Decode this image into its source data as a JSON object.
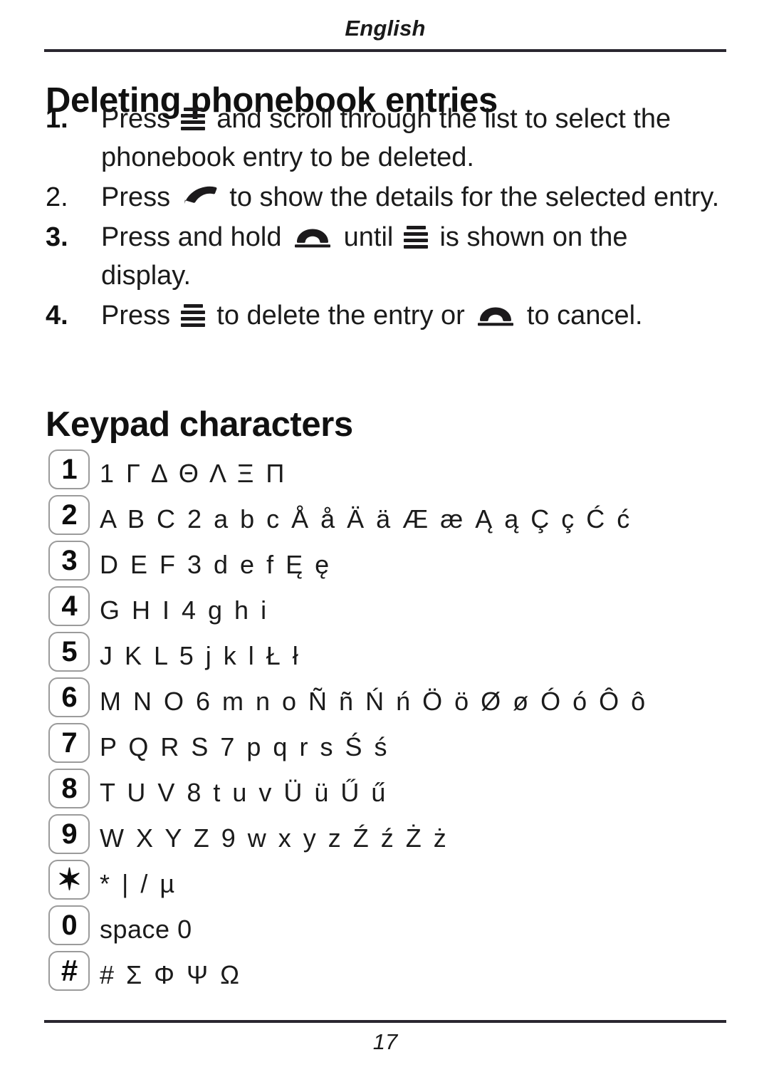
{
  "running_head": "English",
  "headings": {
    "deleting": "Deleting phonebook entries",
    "keypad": "Keypad characters"
  },
  "steps": [
    {
      "number": "1.",
      "bold": true,
      "parts": [
        {
          "type": "text",
          "value": "Press "
        },
        {
          "type": "icon",
          "icon": "menu-icon"
        },
        {
          "type": "text",
          "value": " and scroll through the list to select the phonebook entry to be deleted."
        }
      ],
      "plain_text": "Press ☰ and scroll through the list to select the phonebook entry to be deleted."
    },
    {
      "number": "2.",
      "bold": false,
      "parts": [
        {
          "type": "text",
          "value": "Press "
        },
        {
          "type": "icon",
          "icon": "call-icon"
        },
        {
          "type": "text",
          "value": " to show the details for the selected entry."
        }
      ],
      "plain_text": "Press ☎ to show the details for the selected entry."
    },
    {
      "number": "3.",
      "bold": true,
      "parts": [
        {
          "type": "text",
          "value": "Press and hold "
        },
        {
          "type": "icon",
          "icon": "end-call-icon"
        },
        {
          "type": "text",
          "value": " until "
        },
        {
          "type": "icon",
          "icon": "menu-icon"
        },
        {
          "type": "text",
          "value": " is shown on the display."
        }
      ],
      "plain_text": "Press and hold ☎ until ☰ is shown on the display."
    },
    {
      "number": "4.",
      "bold": true,
      "parts": [
        {
          "type": "text",
          "value": "Press "
        },
        {
          "type": "icon",
          "icon": "menu-icon"
        },
        {
          "type": "text",
          "value": " to delete the entry or "
        },
        {
          "type": "icon",
          "icon": "end-call-icon"
        },
        {
          "type": "text",
          "value": " to cancel."
        }
      ],
      "plain_text": "Press ☰ to delete the entry or ☎ to cancel."
    }
  ],
  "keypad_rows": [
    {
      "key": "1",
      "key_name": "key-1",
      "chars": "1 Γ Δ Θ Λ Ξ Π",
      "spaced": true
    },
    {
      "key": "2",
      "key_name": "key-2",
      "chars": "A B C 2 a b c Å å Ä ä Æ æ Ą ą Ç ç Ć ć",
      "spaced": true
    },
    {
      "key": "3",
      "key_name": "key-3",
      "chars": "D E F 3 d e f Ę ę",
      "spaced": true
    },
    {
      "key": "4",
      "key_name": "key-4",
      "chars": "G H I 4 g h i",
      "spaced": true
    },
    {
      "key": "5",
      "key_name": "key-5",
      "chars": "J K L 5 j k l Ł ł",
      "spaced": true
    },
    {
      "key": "6",
      "key_name": "key-6",
      "chars": "M N O 6 m n o Ñ ñ Ń ń Ö ö Ø ø Ó ó Ô ô",
      "spaced": true
    },
    {
      "key": "7",
      "key_name": "key-7",
      "chars": "P Q R S 7 p q r s Ś ś",
      "spaced": true
    },
    {
      "key": "8",
      "key_name": "key-8",
      "chars": "T U V 8 t u v Ü ü Ű ű",
      "spaced": true
    },
    {
      "key": "9",
      "key_name": "key-9",
      "chars": "W X Y Z 9 w x y z Ź ź Ż ż",
      "spaced": true
    },
    {
      "key": "✶",
      "key_name": "key-star",
      "chars": "* | / µ",
      "spaced": true
    },
    {
      "key": "0",
      "key_name": "key-0",
      "chars": "space 0",
      "spaced": false
    },
    {
      "key": "#",
      "key_name": "key-hash",
      "chars": "# Σ Φ Ψ Ω",
      "spaced": true
    }
  ],
  "folio": "17",
  "colors": {
    "text": "#1b1b1b",
    "rule": "#2a2730",
    "key_border": "#9b9b9b",
    "page_background": "#ffffff"
  }
}
